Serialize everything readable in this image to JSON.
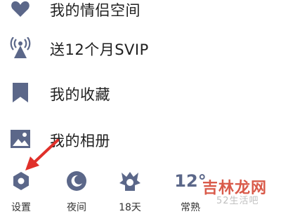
{
  "menu": {
    "items": [
      {
        "label": "我的情侣空间",
        "icon": "heart-icon"
      },
      {
        "label": "送12个月SVIP",
        "icon": "broadcast-icon"
      },
      {
        "label": "我的收藏",
        "icon": "bookmark-icon"
      },
      {
        "label": "我的相册",
        "icon": "image-icon"
      }
    ]
  },
  "bottom_bar": {
    "items": [
      {
        "label": "设置",
        "icon": "gear-icon"
      },
      {
        "label": "夜间",
        "icon": "moon-icon"
      },
      {
        "label": "18天",
        "icon": "sun-badge-icon"
      },
      {
        "label": "常熟",
        "icon": "weather-icon",
        "value": "12°"
      }
    ]
  },
  "watermark": {
    "site": "吉林龙网",
    "sub": "52生活吧"
  },
  "colors": {
    "icon": "#5b6789",
    "arrow": "#e0302a",
    "watermark": "#d95a4a"
  }
}
